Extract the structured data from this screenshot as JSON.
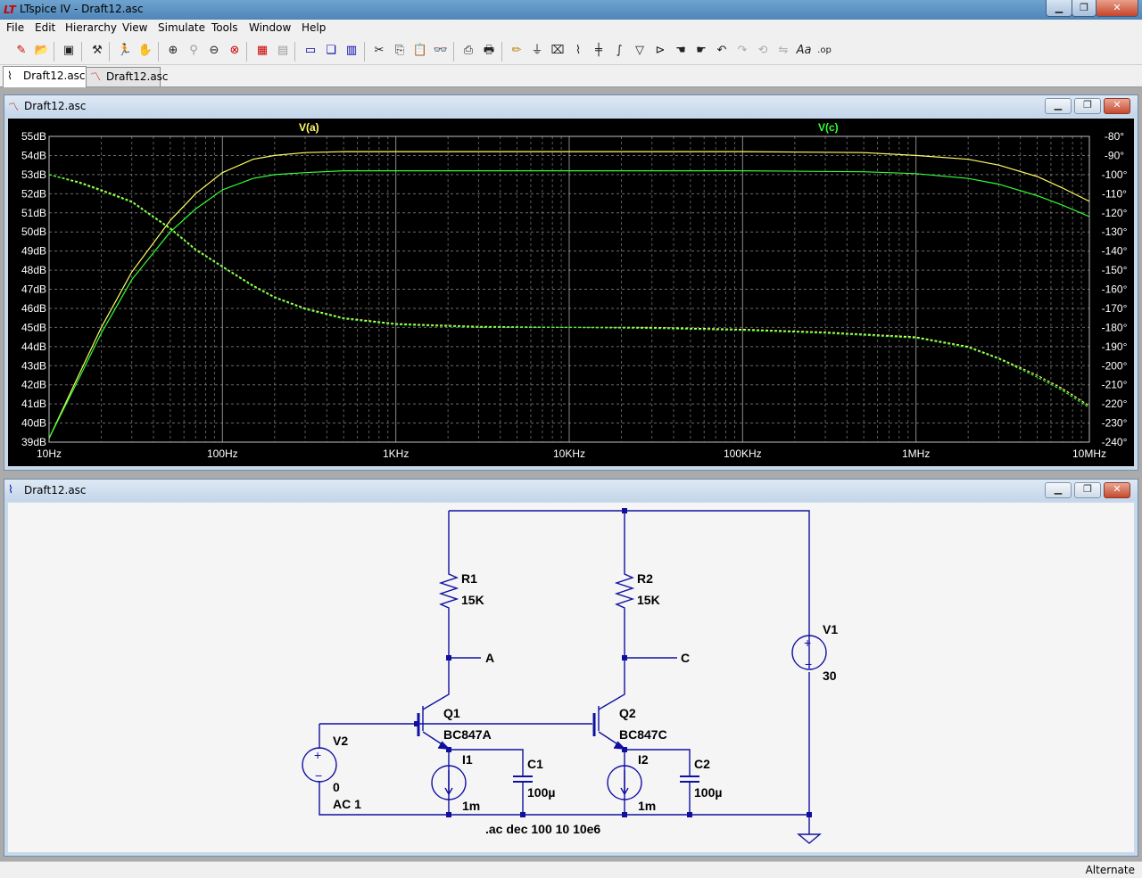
{
  "window": {
    "title": "LTspice IV - Draft12.asc",
    "app_icon": "ltspice-logo-icon"
  },
  "menu": {
    "items": [
      {
        "label": "File"
      },
      {
        "label": "Edit"
      },
      {
        "label": "Hierarchy"
      },
      {
        "label": "View"
      },
      {
        "label": "Simulate"
      },
      {
        "label": "Tools"
      },
      {
        "label": "Window"
      },
      {
        "label": "Help"
      }
    ]
  },
  "tabs": [
    {
      "label": "Draft12.asc",
      "icon": "schematic-icon",
      "active": true
    },
    {
      "label": "Draft12.asc",
      "icon": "waveform-icon",
      "active": false
    }
  ],
  "plot_window": {
    "title": "Draft12.asc",
    "traces": [
      {
        "label": "V(a)",
        "color": "#ffff66"
      },
      {
        "label": "V(c)",
        "color": "#33ff33"
      }
    ],
    "colors": {
      "background": "#000000",
      "axis_text": "#ffffff",
      "grid": "#9a9a9a"
    }
  },
  "chart_data": {
    "type": "line",
    "title": "",
    "xscale": "log",
    "xlim": [
      10,
      10000000
    ],
    "x_ticks": [
      "10Hz",
      "100Hz",
      "1KHz",
      "10KHz",
      "100KHz",
      "1MHz",
      "10MHz"
    ],
    "ylim_left": [
      39,
      55
    ],
    "y_ticks_left": [
      "55dB",
      "54dB",
      "53dB",
      "52dB",
      "51dB",
      "50dB",
      "49dB",
      "48dB",
      "47dB",
      "46dB",
      "45dB",
      "44dB",
      "43dB",
      "42dB",
      "41dB",
      "40dB",
      "39dB"
    ],
    "ylim_right": [
      -240,
      -80
    ],
    "y_ticks_right": [
      "-80°",
      "-90°",
      "-100°",
      "-110°",
      "-120°",
      "-130°",
      "-140°",
      "-150°",
      "-160°",
      "-170°",
      "-180°",
      "-190°",
      "-200°",
      "-210°",
      "-220°",
      "-230°",
      "-240°"
    ],
    "grid": true,
    "series": [
      {
        "name": "V(a)",
        "axis": "magnitude",
        "color": "#ffff66",
        "x": [
          10,
          15,
          20,
          30,
          50,
          70,
          100,
          150,
          200,
          300,
          500,
          1000,
          10000,
          100000,
          500000,
          1000000,
          2000000,
          3000000,
          5000000,
          7000000,
          10000000
        ],
        "y": [
          39.2,
          42.6,
          45.0,
          47.9,
          50.6,
          52.0,
          53.1,
          53.8,
          54.0,
          54.15,
          54.2,
          54.2,
          54.2,
          54.2,
          54.15,
          54.0,
          53.8,
          53.5,
          52.9,
          52.3,
          51.6
        ]
      },
      {
        "name": "V(c)",
        "axis": "magnitude",
        "color": "#33ff33",
        "x": [
          10,
          15,
          20,
          30,
          50,
          70,
          100,
          150,
          200,
          300,
          500,
          1000,
          10000,
          100000,
          500000,
          1000000,
          2000000,
          3000000,
          5000000,
          7000000,
          10000000
        ],
        "y": [
          39.2,
          42.4,
          44.7,
          47.5,
          50.0,
          51.2,
          52.2,
          52.8,
          53.0,
          53.1,
          53.2,
          53.2,
          53.2,
          53.2,
          53.15,
          53.05,
          52.8,
          52.5,
          51.9,
          51.4,
          50.8
        ]
      },
      {
        "name": "V(a) phase",
        "axis": "phase",
        "color": "#ffff66",
        "dashed": true,
        "x": [
          10,
          15,
          20,
          30,
          50,
          70,
          100,
          150,
          200,
          300,
          500,
          1000,
          3000,
          10000,
          30000,
          100000,
          300000,
          1000000,
          2000000,
          3000000,
          5000000,
          7000000,
          10000000
        ],
        "y": [
          -100,
          -104,
          -108,
          -114,
          -128,
          -139,
          -148,
          -158,
          -164,
          -170,
          -175,
          -178,
          -179.5,
          -180,
          -180,
          -181,
          -182.5,
          -185,
          -190,
          -196,
          -205,
          -212,
          -221
        ]
      },
      {
        "name": "V(c) phase",
        "axis": "phase",
        "color": "#33ff33",
        "dashed": true,
        "x": [
          10,
          15,
          20,
          30,
          50,
          70,
          100,
          150,
          200,
          300,
          500,
          1000,
          3000,
          10000,
          30000,
          100000,
          300000,
          1000000,
          2000000,
          3000000,
          5000000,
          7000000,
          10000000
        ],
        "y": [
          -100,
          -104.5,
          -108.5,
          -114.5,
          -128.5,
          -139.5,
          -148.5,
          -158.5,
          -164.5,
          -170.5,
          -175.5,
          -178.5,
          -180,
          -180,
          -180.5,
          -181.5,
          -183,
          -185.5,
          -190.5,
          -196.5,
          -206,
          -213,
          -222
        ]
      }
    ]
  },
  "schematic_window": {
    "title": "Draft12.asc",
    "wire_color": "#1010a0",
    "components": {
      "R1": {
        "name": "R1",
        "value": "15K"
      },
      "R2": {
        "name": "R2",
        "value": "15K"
      },
      "V1": {
        "name": "V1",
        "value": "30"
      },
      "V2": {
        "name": "V2",
        "value": "0",
        "ac": "AC 1"
      },
      "Q1": {
        "name": "Q1",
        "model": "BC847A"
      },
      "Q2": {
        "name": "Q2",
        "model": "BC847C"
      },
      "I1": {
        "name": "I1",
        "value": "1m"
      },
      "I2": {
        "name": "I2",
        "value": "1m"
      },
      "C1": {
        "name": "C1",
        "value": "100µ"
      },
      "C2": {
        "name": "C2",
        "value": "100µ"
      }
    },
    "net_labels": {
      "a": "A",
      "c": "C"
    },
    "directive": ".ac dec 100 10 10e6"
  },
  "statusbar": {
    "text": "Alternate"
  }
}
